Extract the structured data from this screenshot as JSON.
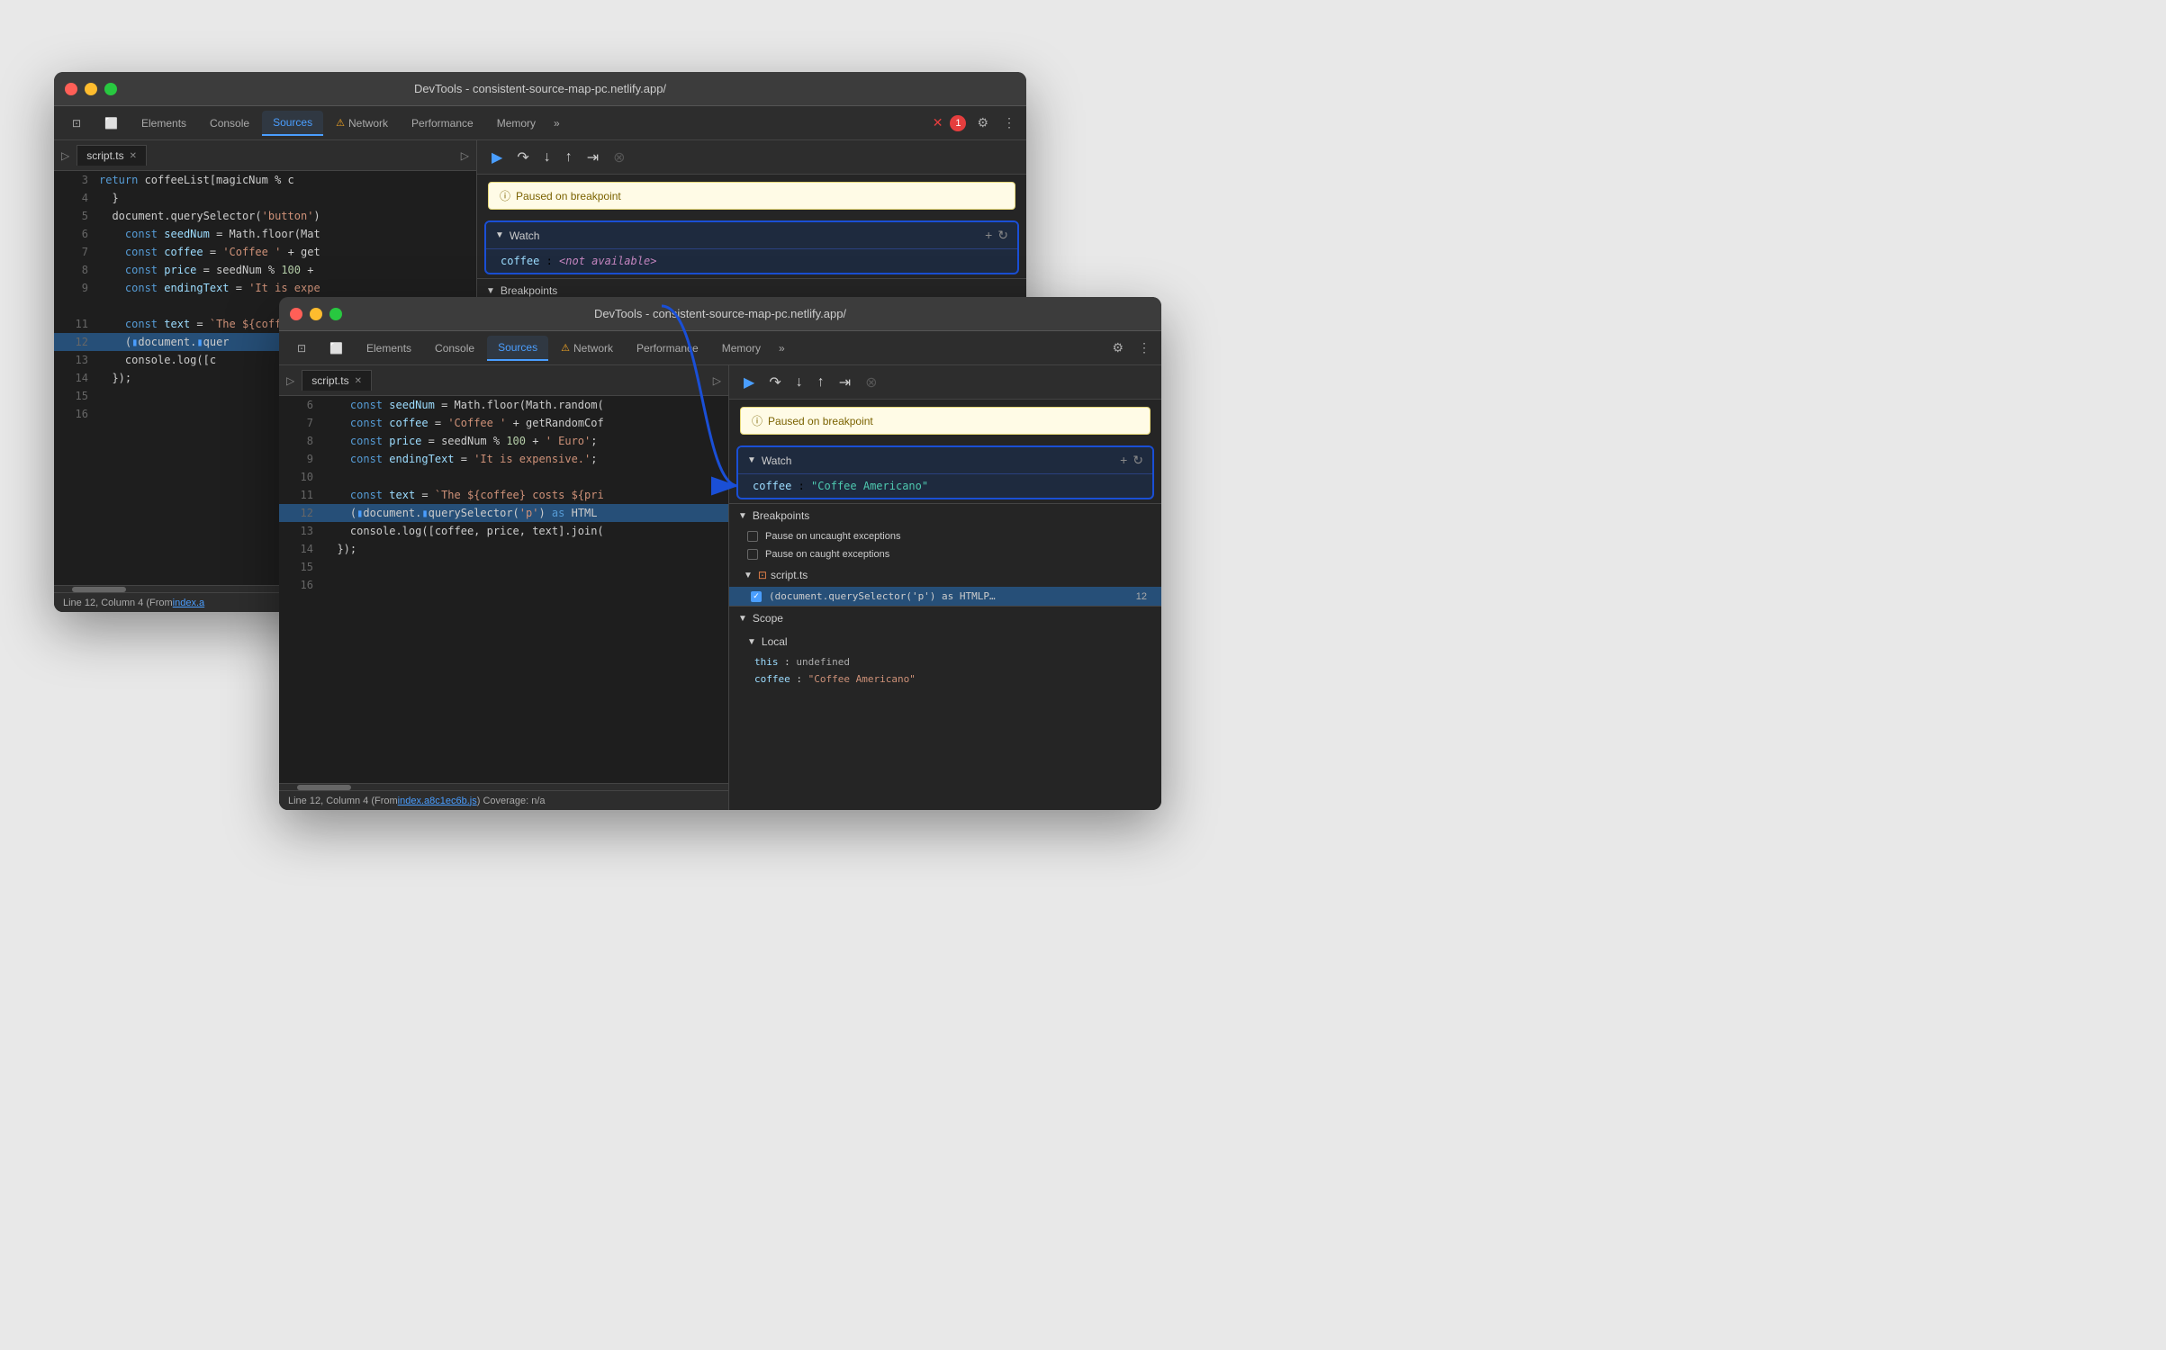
{
  "window1": {
    "title": "DevTools - consistent-source-map-pc.netlify.app/",
    "tabs": [
      "Elements",
      "Console",
      "Sources",
      "Network",
      "Performance",
      "Memory"
    ],
    "active_tab": "Sources",
    "network_warning": true,
    "error_count": "1",
    "file_tab": "script.ts",
    "code_lines": [
      {
        "num": "3",
        "content": "    return coffeeList[magicNum % c"
      },
      {
        "num": "4",
        "content": "  }"
      },
      {
        "num": "5",
        "content": "  document.querySelector('button')"
      },
      {
        "num": "6",
        "content": "    const seedNum = Math.floor(Mat"
      },
      {
        "num": "7",
        "content": "    const coffee = 'Coffee ' + get"
      },
      {
        "num": "8",
        "content": "    const price = seedNum % 100 + "
      },
      {
        "num": "9",
        "content": "    const endingText = 'It is expe"
      },
      {
        "num": "11",
        "content": "    const text = `The ${coffee} c"
      },
      {
        "num": "12",
        "content": "    (document.querySelector"
      },
      {
        "num": "13",
        "content": "    console.log([c"
      },
      {
        "num": "14",
        "content": "  });"
      },
      {
        "num": "15",
        "content": ""
      },
      {
        "num": "16",
        "content": ""
      }
    ],
    "breakpoint_notice": "Paused on breakpoint",
    "watch_label": "Watch",
    "watch_item_key": "coffee",
    "watch_item_value": "<not available>",
    "breakpoints_label": "Breakpoints",
    "status": "Line 12, Column 4 (From ",
    "status_link": "index.a"
  },
  "window2": {
    "title": "DevTools - consistent-source-map-pc.netlify.app/",
    "tabs": [
      "Elements",
      "Console",
      "Sources",
      "Network",
      "Performance",
      "Memory"
    ],
    "active_tab": "Sources",
    "network_warning": true,
    "file_tab": "script.ts",
    "code_lines": [
      {
        "num": "6",
        "content": "    const seedNum = Math.floor(Math.random("
      },
      {
        "num": "7",
        "content": "    const coffee = 'Coffee ' + getRandomCof"
      },
      {
        "num": "8",
        "content": "    const price = seedNum % 100 + ' Euro';"
      },
      {
        "num": "9",
        "content": "    const endingText = 'It is expensive.';"
      },
      {
        "num": "10",
        "content": ""
      },
      {
        "num": "11",
        "content": "    const text = `The ${coffee} costs ${pri"
      },
      {
        "num": "12",
        "content": "    (document.querySelector('p') as HTML"
      },
      {
        "num": "13",
        "content": "    console.log([coffee, price, text].join("
      },
      {
        "num": "14",
        "content": "  });"
      },
      {
        "num": "15",
        "content": ""
      },
      {
        "num": "16",
        "content": ""
      }
    ],
    "breakpoint_notice": "Paused on breakpoint",
    "watch_label": "Watch",
    "watch_item_key": "coffee",
    "watch_item_value": "\"Coffee Americano\"",
    "breakpoints_label": "Breakpoints",
    "bp_check1": "Pause on uncaught exceptions",
    "bp_check2": "Pause on caught exceptions",
    "bp_file": "script.ts",
    "bp_line_content": "(document.querySelector('p') as HTMLP…",
    "bp_line_num": "12",
    "scope_label": "Scope",
    "local_label": "Local",
    "scope_this": "undefined",
    "scope_coffee": "\"Coffee Americano\"",
    "status": "Line 12, Column 4  (From ",
    "status_link": "index.a8c1ec6b.js",
    "status_coverage": ") Coverage: n/a"
  },
  "icons": {
    "play": "▶",
    "step_over": "↺",
    "step_into": "↓",
    "step_out": "↑",
    "step_fwd": "⇥",
    "deactivate": "⊗",
    "plus": "+",
    "refresh": "↻",
    "gear": "⚙",
    "more": "⋮",
    "more_tabs": "»",
    "info": "ⓘ",
    "triangle_right": "▶",
    "triangle_down": "▼",
    "close_x": "✕",
    "checkbox_checked": "✓"
  }
}
